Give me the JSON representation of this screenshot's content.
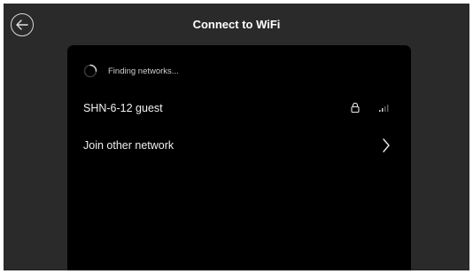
{
  "header": {
    "title": "Connect to WiFi"
  },
  "status": {
    "finding_text": "Finding networks..."
  },
  "networks": [
    {
      "ssid": "SHN-6-12 guest",
      "secured": true,
      "signal_bars": 2,
      "signal_bars_total": 4
    }
  ],
  "join_other": {
    "label": "Join other network"
  },
  "colors": {
    "screen_bg": "#2a2a2a",
    "panel_bg": "#000000",
    "text": "#f0f0f0"
  }
}
